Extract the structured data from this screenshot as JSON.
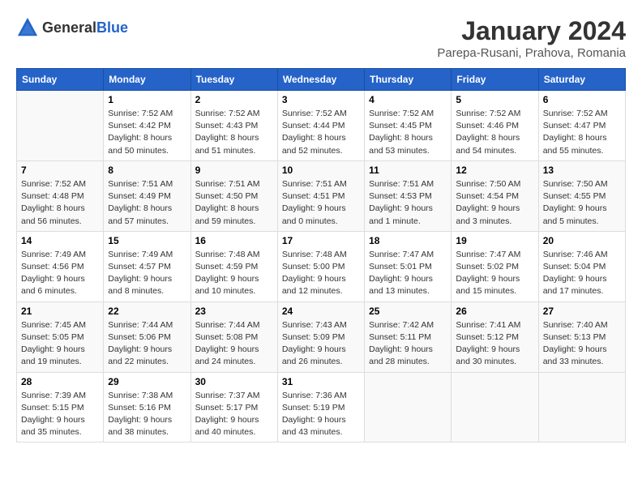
{
  "header": {
    "logo_general": "General",
    "logo_blue": "Blue",
    "title": "January 2024",
    "location": "Parepa-Rusani, Prahova, Romania"
  },
  "weekdays": [
    "Sunday",
    "Monday",
    "Tuesday",
    "Wednesday",
    "Thursday",
    "Friday",
    "Saturday"
  ],
  "weeks": [
    [
      {
        "day": "",
        "info": ""
      },
      {
        "day": "1",
        "info": "Sunrise: 7:52 AM\nSunset: 4:42 PM\nDaylight: 8 hours\nand 50 minutes."
      },
      {
        "day": "2",
        "info": "Sunrise: 7:52 AM\nSunset: 4:43 PM\nDaylight: 8 hours\nand 51 minutes."
      },
      {
        "day": "3",
        "info": "Sunrise: 7:52 AM\nSunset: 4:44 PM\nDaylight: 8 hours\nand 52 minutes."
      },
      {
        "day": "4",
        "info": "Sunrise: 7:52 AM\nSunset: 4:45 PM\nDaylight: 8 hours\nand 53 minutes."
      },
      {
        "day": "5",
        "info": "Sunrise: 7:52 AM\nSunset: 4:46 PM\nDaylight: 8 hours\nand 54 minutes."
      },
      {
        "day": "6",
        "info": "Sunrise: 7:52 AM\nSunset: 4:47 PM\nDaylight: 8 hours\nand 55 minutes."
      }
    ],
    [
      {
        "day": "7",
        "info": "Sunrise: 7:52 AM\nSunset: 4:48 PM\nDaylight: 8 hours\nand 56 minutes."
      },
      {
        "day": "8",
        "info": "Sunrise: 7:51 AM\nSunset: 4:49 PM\nDaylight: 8 hours\nand 57 minutes."
      },
      {
        "day": "9",
        "info": "Sunrise: 7:51 AM\nSunset: 4:50 PM\nDaylight: 8 hours\nand 59 minutes."
      },
      {
        "day": "10",
        "info": "Sunrise: 7:51 AM\nSunset: 4:51 PM\nDaylight: 9 hours\nand 0 minutes."
      },
      {
        "day": "11",
        "info": "Sunrise: 7:51 AM\nSunset: 4:53 PM\nDaylight: 9 hours\nand 1 minute."
      },
      {
        "day": "12",
        "info": "Sunrise: 7:50 AM\nSunset: 4:54 PM\nDaylight: 9 hours\nand 3 minutes."
      },
      {
        "day": "13",
        "info": "Sunrise: 7:50 AM\nSunset: 4:55 PM\nDaylight: 9 hours\nand 5 minutes."
      }
    ],
    [
      {
        "day": "14",
        "info": "Sunrise: 7:49 AM\nSunset: 4:56 PM\nDaylight: 9 hours\nand 6 minutes."
      },
      {
        "day": "15",
        "info": "Sunrise: 7:49 AM\nSunset: 4:57 PM\nDaylight: 9 hours\nand 8 minutes."
      },
      {
        "day": "16",
        "info": "Sunrise: 7:48 AM\nSunset: 4:59 PM\nDaylight: 9 hours\nand 10 minutes."
      },
      {
        "day": "17",
        "info": "Sunrise: 7:48 AM\nSunset: 5:00 PM\nDaylight: 9 hours\nand 12 minutes."
      },
      {
        "day": "18",
        "info": "Sunrise: 7:47 AM\nSunset: 5:01 PM\nDaylight: 9 hours\nand 13 minutes."
      },
      {
        "day": "19",
        "info": "Sunrise: 7:47 AM\nSunset: 5:02 PM\nDaylight: 9 hours\nand 15 minutes."
      },
      {
        "day": "20",
        "info": "Sunrise: 7:46 AM\nSunset: 5:04 PM\nDaylight: 9 hours\nand 17 minutes."
      }
    ],
    [
      {
        "day": "21",
        "info": "Sunrise: 7:45 AM\nSunset: 5:05 PM\nDaylight: 9 hours\nand 19 minutes."
      },
      {
        "day": "22",
        "info": "Sunrise: 7:44 AM\nSunset: 5:06 PM\nDaylight: 9 hours\nand 22 minutes."
      },
      {
        "day": "23",
        "info": "Sunrise: 7:44 AM\nSunset: 5:08 PM\nDaylight: 9 hours\nand 24 minutes."
      },
      {
        "day": "24",
        "info": "Sunrise: 7:43 AM\nSunset: 5:09 PM\nDaylight: 9 hours\nand 26 minutes."
      },
      {
        "day": "25",
        "info": "Sunrise: 7:42 AM\nSunset: 5:11 PM\nDaylight: 9 hours\nand 28 minutes."
      },
      {
        "day": "26",
        "info": "Sunrise: 7:41 AM\nSunset: 5:12 PM\nDaylight: 9 hours\nand 30 minutes."
      },
      {
        "day": "27",
        "info": "Sunrise: 7:40 AM\nSunset: 5:13 PM\nDaylight: 9 hours\nand 33 minutes."
      }
    ],
    [
      {
        "day": "28",
        "info": "Sunrise: 7:39 AM\nSunset: 5:15 PM\nDaylight: 9 hours\nand 35 minutes."
      },
      {
        "day": "29",
        "info": "Sunrise: 7:38 AM\nSunset: 5:16 PM\nDaylight: 9 hours\nand 38 minutes."
      },
      {
        "day": "30",
        "info": "Sunrise: 7:37 AM\nSunset: 5:17 PM\nDaylight: 9 hours\nand 40 minutes."
      },
      {
        "day": "31",
        "info": "Sunrise: 7:36 AM\nSunset: 5:19 PM\nDaylight: 9 hours\nand 43 minutes."
      },
      {
        "day": "",
        "info": ""
      },
      {
        "day": "",
        "info": ""
      },
      {
        "day": "",
        "info": ""
      }
    ]
  ]
}
